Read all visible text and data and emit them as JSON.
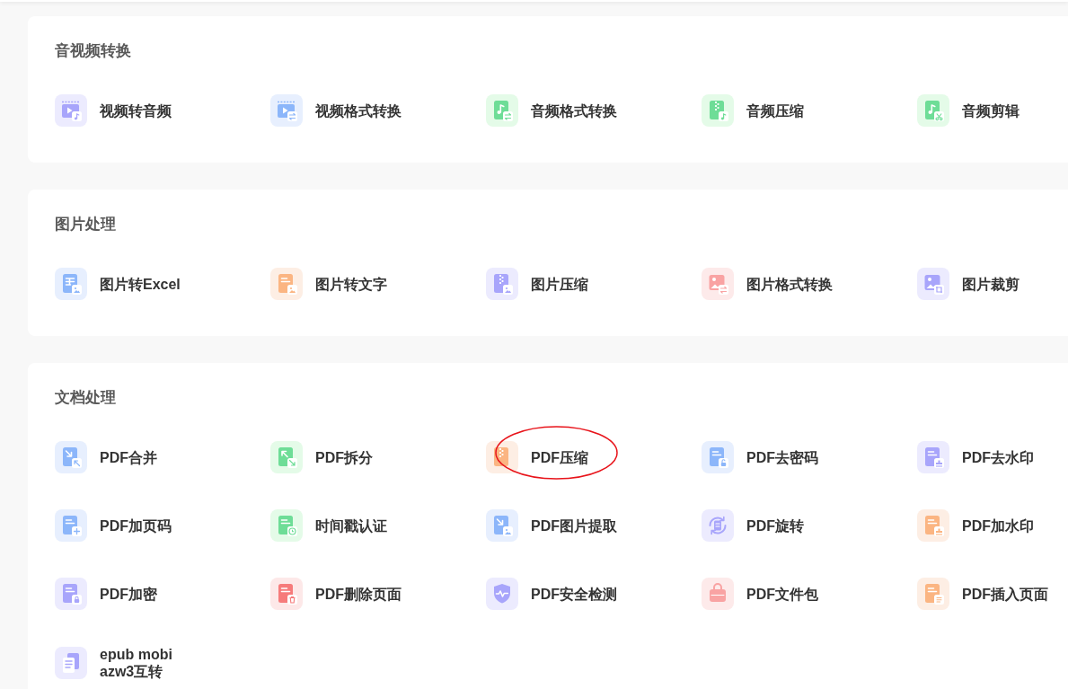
{
  "sections": [
    {
      "title": "音视频转换",
      "items": [
        {
          "label": "视频转音频",
          "circled": false
        },
        {
          "label": "视频格式转换",
          "circled": false
        },
        {
          "label": "音频格式转换",
          "circled": false
        },
        {
          "label": "音频压缩",
          "circled": false
        },
        {
          "label": "音频剪辑",
          "circled": false
        }
      ]
    },
    {
      "title": "图片处理",
      "items": [
        {
          "label": "图片转Excel",
          "circled": false
        },
        {
          "label": "图片转文字",
          "circled": false
        },
        {
          "label": "图片压缩",
          "circled": false
        },
        {
          "label": "图片格式转换",
          "circled": false
        },
        {
          "label": "图片裁剪",
          "circled": false
        }
      ]
    },
    {
      "title": "文档处理",
      "items": [
        {
          "label": "PDF合并",
          "circled": false
        },
        {
          "label": "PDF拆分",
          "circled": false
        },
        {
          "label": "PDF压缩",
          "circled": true
        },
        {
          "label": "PDF去密码",
          "circled": false
        },
        {
          "label": "PDF去水印",
          "circled": false
        },
        {
          "label": "PDF加页码",
          "circled": false
        },
        {
          "label": "时间戳认证",
          "circled": false
        },
        {
          "label": "PDF图片提取",
          "circled": false
        },
        {
          "label": "PDF旋转",
          "circled": false
        },
        {
          "label": "PDF加水印",
          "circled": false
        },
        {
          "label": "PDF加密",
          "circled": false
        },
        {
          "label": "PDF删除页面",
          "circled": false
        },
        {
          "label": "PDF安全检测",
          "circled": false
        },
        {
          "label": "PDF文件包",
          "circled": false
        },
        {
          "label": "PDF插入页面",
          "circled": false
        },
        {
          "label": "epub mobi azw3互转",
          "circled": false
        }
      ]
    }
  ]
}
